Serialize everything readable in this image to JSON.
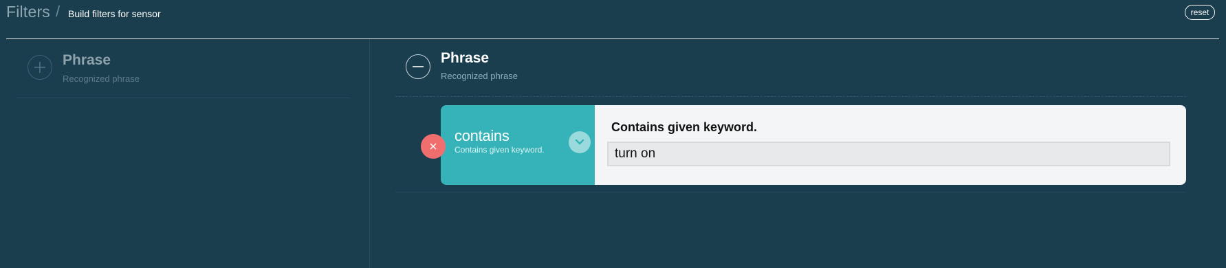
{
  "header": {
    "title": "Filters",
    "separator": "/",
    "subtitle": "Build filters for sensor",
    "reset_label": "reset"
  },
  "available_filters": [
    {
      "name": "Phrase",
      "description": "Recognized phrase",
      "action_icon": "plus-icon"
    }
  ],
  "active_filters": [
    {
      "name": "Phrase",
      "description": "Recognized phrase",
      "action_icon": "minus-icon",
      "rules": [
        {
          "operator": "contains",
          "operator_description": "Contains given keyword.",
          "value_title": "Contains given keyword.",
          "value": "turn on",
          "remove_icon": "close-icon",
          "toggle_icon": "chevron-down-icon"
        }
      ]
    }
  ],
  "colors": {
    "background": "#1a3e4e",
    "operator_panel": "#36b3b8",
    "remove_button": "#f06e6e",
    "value_panel": "#f4f5f7"
  }
}
